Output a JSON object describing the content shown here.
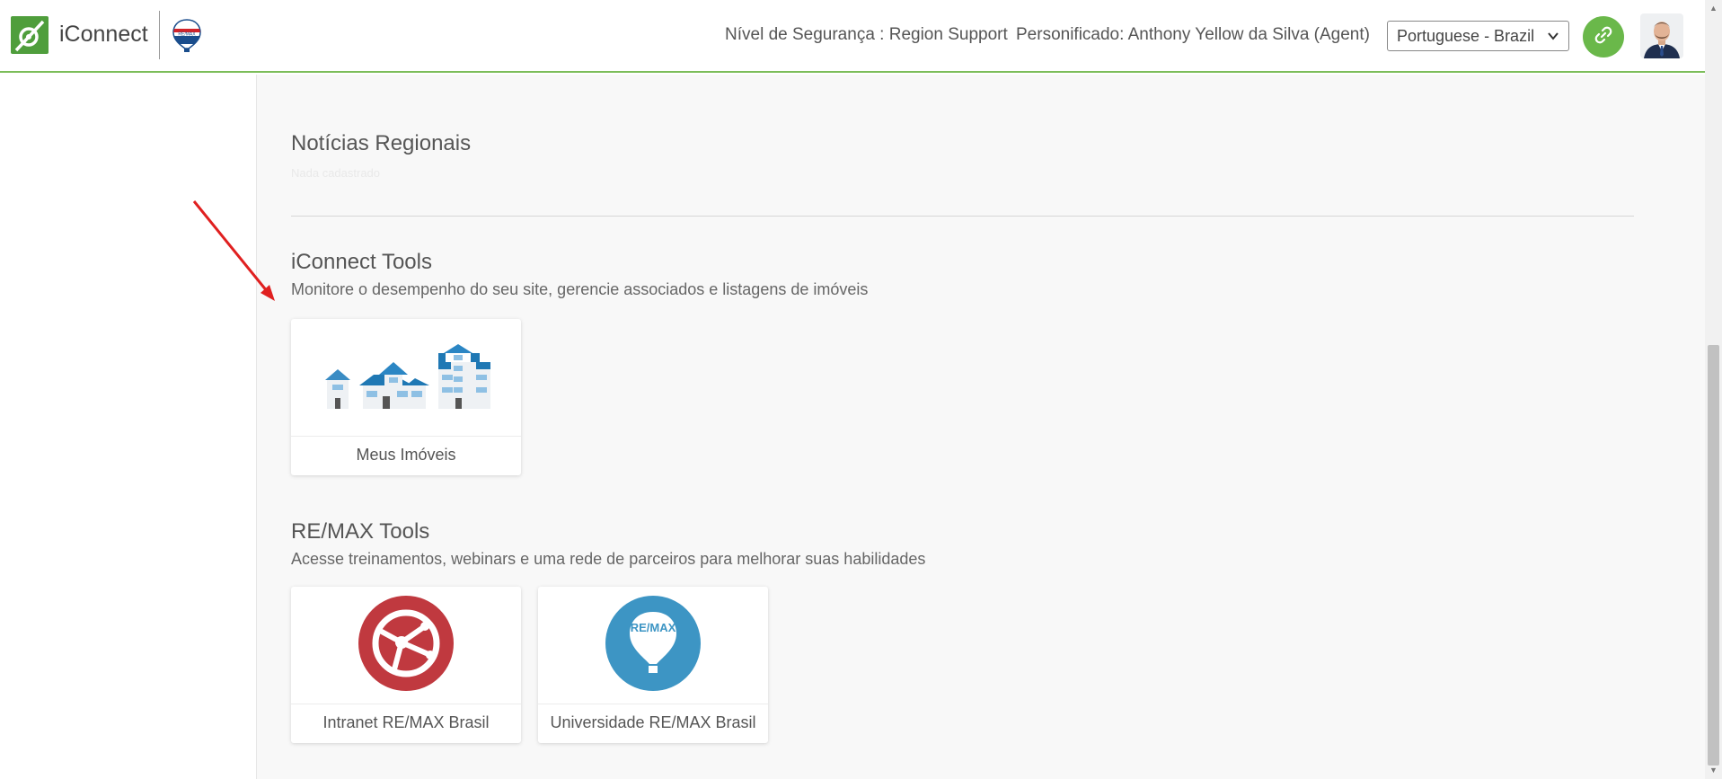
{
  "header": {
    "brand": "iConnect",
    "security_level": "Nível de Segurança : Region Support",
    "impersonated": "Personificado: Anthony Yellow da Silva (Agent)",
    "language_selected": "Portuguese - Brazil",
    "remax_logo_text": "RE/MAX"
  },
  "regional_news": {
    "title": "Notícias Regionais",
    "empty_hint": "Nada cadastrado"
  },
  "iconnect_tools": {
    "title": "iConnect Tools",
    "subtitle": "Monitore o desempenho do seu site, gerencie associados e listagens de imóveis",
    "cards": [
      {
        "label": "Meus Imóveis",
        "icon": "houses-icon"
      }
    ]
  },
  "remax_tools": {
    "title": "RE/MAX Tools",
    "subtitle": "Acesse treinamentos, webinars e uma rede de parceiros para melhorar suas habilidades",
    "cards": [
      {
        "label": "Intranet RE/MAX Brasil",
        "icon": "globe-network-icon",
        "color": "#c0393f"
      },
      {
        "label": "Universidade RE/MAX Brasil",
        "icon": "balloon-icon",
        "color": "#3d95c4",
        "balloon_text": "RE/MAX"
      }
    ]
  },
  "colors": {
    "accent_green": "#6ab84a",
    "header_border": "#7cbd5a",
    "annotation_arrow": "#e02020"
  }
}
